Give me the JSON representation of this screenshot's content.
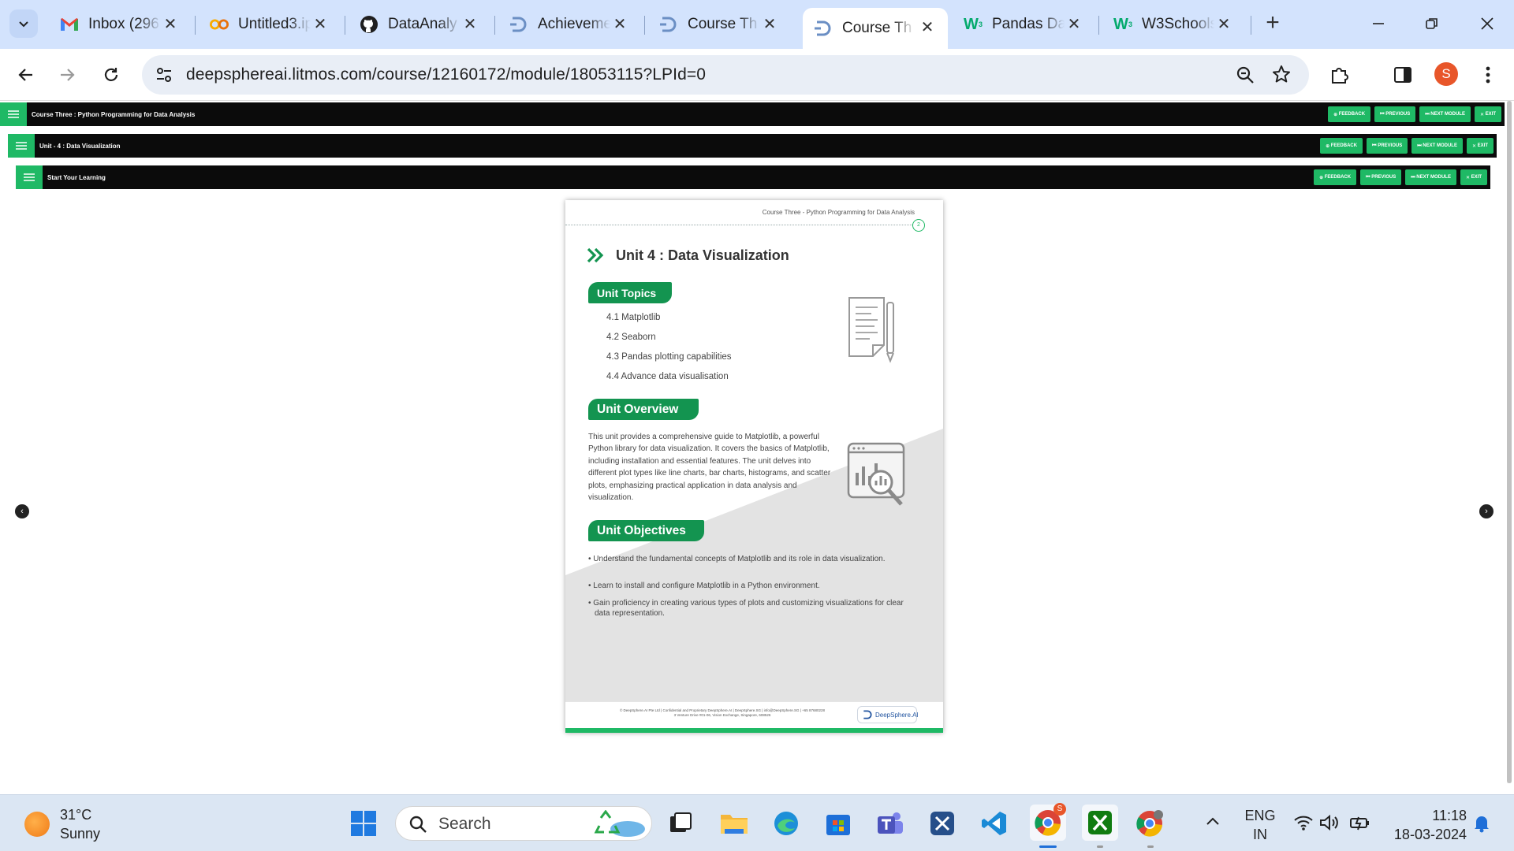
{
  "browser": {
    "tabs": [
      {
        "title": "Inbox (296",
        "icon": "gmail-icon"
      },
      {
        "title": "Untitled3.ip",
        "icon": "colab-icon"
      },
      {
        "title": "DataAnaly",
        "icon": "github-icon"
      },
      {
        "title": "Achieveme",
        "icon": "deepsphere-icon"
      },
      {
        "title": "Course Th",
        "icon": "deepsphere-icon"
      },
      {
        "title": "Course Th",
        "icon": "deepsphere-icon",
        "active": true
      },
      {
        "title": "Pandas Da",
        "icon": "w3schools-icon"
      },
      {
        "title": "W3Schools",
        "icon": "w3schools-icon"
      }
    ],
    "url": "deepsphereai.litmos.com/course/12160172/module/18053115?LPId=0",
    "profile_initial": "S"
  },
  "lms": {
    "bars": [
      {
        "title": "Course Three : Python Programming for Data Analysis"
      },
      {
        "title": "Unit - 4 : Data Visualization"
      },
      {
        "title": "Start Your Learning"
      }
    ],
    "buttons": {
      "feedback": "FEEDBACK",
      "previous": "PREVIOUS",
      "next_module": "NEXT MODULE",
      "exit": "EXIT"
    }
  },
  "document": {
    "running_head": "Course Three - Python Programming for Data Analysis",
    "page_number": "2",
    "unit_title": "Unit 4 : Data Visualization",
    "topics_heading": "Unit Topics",
    "topics": [
      "4.1 Matplotlib",
      "4.2 Seaborn",
      "4.3 Pandas plotting capabilities",
      "4.4 Advance data visualisation"
    ],
    "overview_heading": "Unit Overview",
    "overview_text": "This unit provides a comprehensive guide to Matplotlib, a powerful Python library for data visualization. It covers the basics of Matplotlib, including installation and essential features. The unit delves into different plot types like line charts, bar charts, histograms, and scatter plots, emphasizing practical application in data analysis and visualization.",
    "objectives_heading": "Unit Objectives",
    "objectives": [
      "• Understand the fundamental concepts of Matplotlib and its role in data visualization.",
      "• Learn to install and configure Matplotlib in a Python environment.",
      "• Gain proficiency in creating various types of plots and customizing visualizations for clear data representation."
    ],
    "footer_line1": "© DeepSphere.AI Pte Ltd | Confidential and Proprietary DeepSphere.AI | DeepSphere.SG | info@DeepSphere.SG | +65 87680228",
    "footer_line2": "3 Venture Drive #01-06, Vision Exchange, Singapore, 608526",
    "footer_logo": "DeepSphere.AI"
  },
  "taskbar": {
    "weather_temp": "31°C",
    "weather_desc": "Sunny",
    "search_label": "Search",
    "lang_line1": "ENG",
    "lang_line2": "IN",
    "time": "11:18",
    "date": "18-03-2024",
    "chrome_badge": "S"
  },
  "colors": {
    "lms_green": "#1fb965",
    "pill_green": "#139450",
    "tabstrip": "#d3e3fd"
  }
}
